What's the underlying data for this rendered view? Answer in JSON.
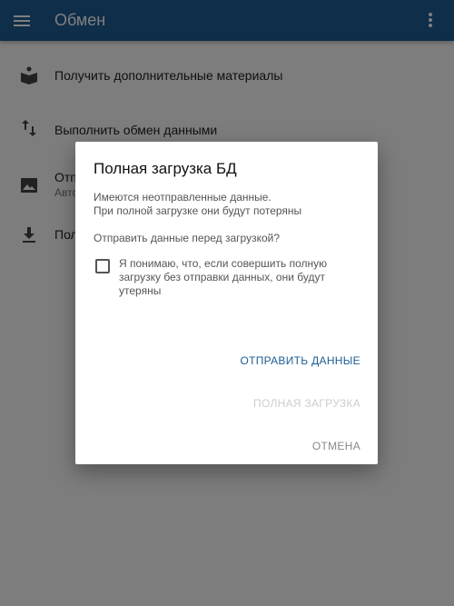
{
  "appbar": {
    "title": "Обмен",
    "menu_icon": "hamburger-menu-icon",
    "more_icon": "more-vertical-icon",
    "color": "#1e5d95"
  },
  "list": {
    "items": [
      {
        "icon": "book-download-icon",
        "primary": "Получить дополнительные материалы",
        "secondary": ""
      },
      {
        "icon": "swap-vertical-icon",
        "primary": "Выполнить обмен данными",
        "secondary": ""
      },
      {
        "icon": "image-icon",
        "primary": "Отп",
        "secondary": "Авто"
      },
      {
        "icon": "download-icon",
        "primary": "Пол",
        "secondary": ""
      }
    ]
  },
  "dialog": {
    "title": "Полная загрузка БД",
    "message_line1": "Имеются неотправленные данные.",
    "message_line2": "При полной загрузке они будут потеряны",
    "question": "Отправить данные перед загрузкой?",
    "checkbox_label": "Я понимаю, что, если совершить полную загрузку без отправки данных, они будут утеряны",
    "checkbox_checked": false,
    "send_button": "ОТПРАВИТЬ ДАННЫЕ",
    "full_load_button": "ПОЛНАЯ ЗАГРУЗКА",
    "cancel_button": "ОТМЕНА",
    "accent_color": "#1e5d95",
    "disabled_color": "#cccccc"
  }
}
